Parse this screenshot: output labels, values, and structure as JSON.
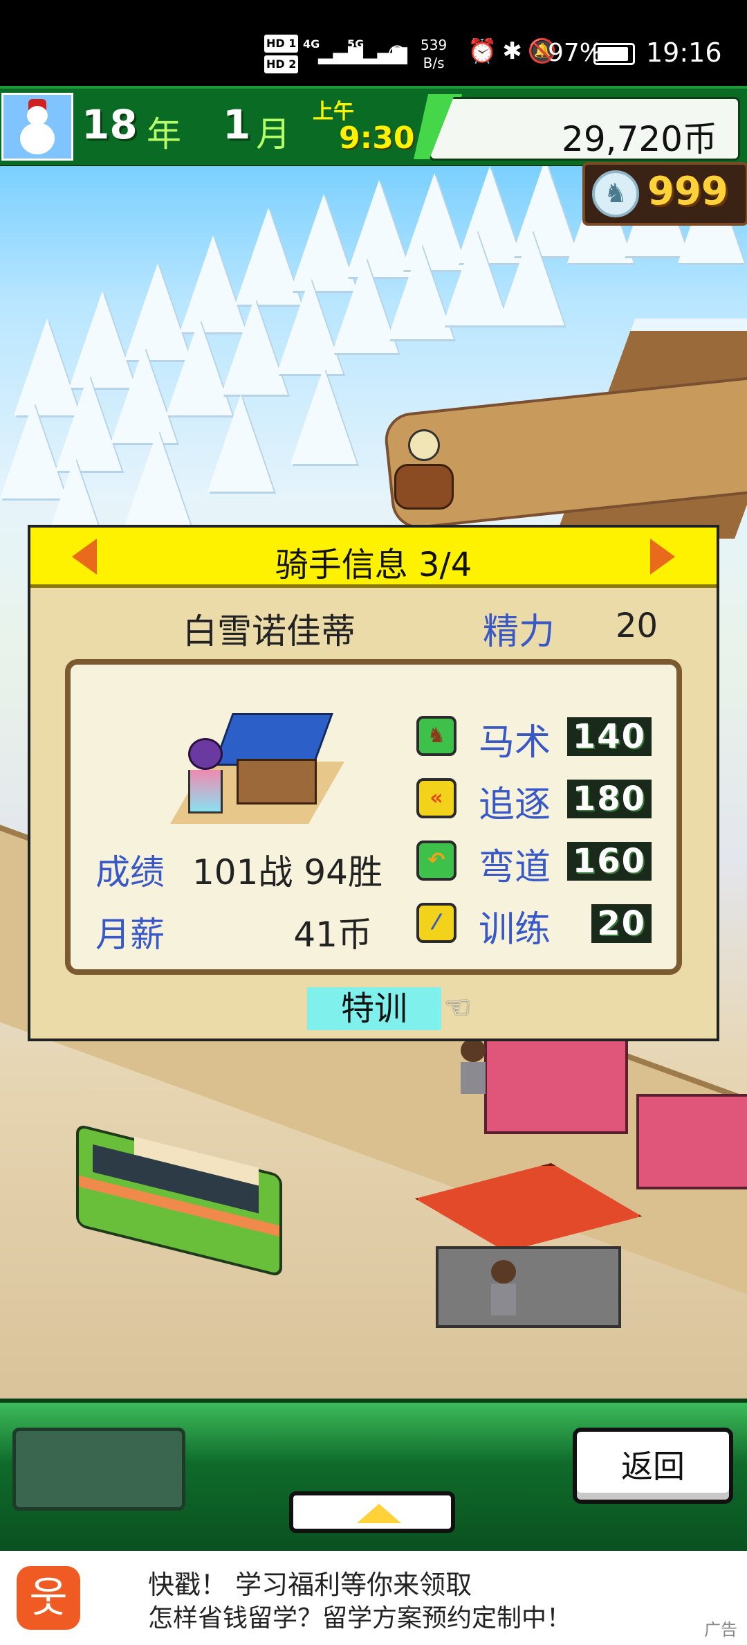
{
  "status_bar": {
    "hd1": "HD 1",
    "hd2": "HD 2",
    "sig1": "4G",
    "sig2": "5G",
    "speed_value": "539",
    "speed_unit": "B/s",
    "battery": "97%",
    "time": "19:16"
  },
  "game_header": {
    "year": "18",
    "year_unit": "年",
    "month": "1",
    "month_unit": "月",
    "ampm": "上午",
    "clock": "9:30",
    "money": "29,720币",
    "gems": "999"
  },
  "dialog": {
    "title": "骑手信息 3/4",
    "name": "白雪诺佳蒂",
    "energy_label": "精力",
    "energy_value": "20",
    "record_label": "成绩",
    "record_value": "101战 94胜",
    "salary_label": "月薪",
    "salary_value": "41币",
    "stats": [
      {
        "label": "马术",
        "value": "140",
        "icon": "horse-icon",
        "color": "#3ec14a"
      },
      {
        "label": "追逐",
        "value": "180",
        "icon": "chevron-icon",
        "color": "#f2d21a"
      },
      {
        "label": "弯道",
        "value": "160",
        "icon": "turn-arrow-icon",
        "color": "#3ec14a"
      },
      {
        "label": "训练",
        "value": "20",
        "icon": "whip-icon",
        "color": "#f2d21a"
      }
    ],
    "train_button": "特训"
  },
  "bottom_bar": {
    "back_button": "返回"
  },
  "ad": {
    "title": "快戳！ 学习福利等你来领取",
    "subtitle": "怎样省钱留学？留学方案预约定制中！",
    "tag": "广告"
  },
  "colors": {
    "accent_yellow": "#fff200",
    "label_blue": "#3958c8",
    "header_green": "#0a6b24",
    "train_cyan": "#7ff0ec"
  }
}
